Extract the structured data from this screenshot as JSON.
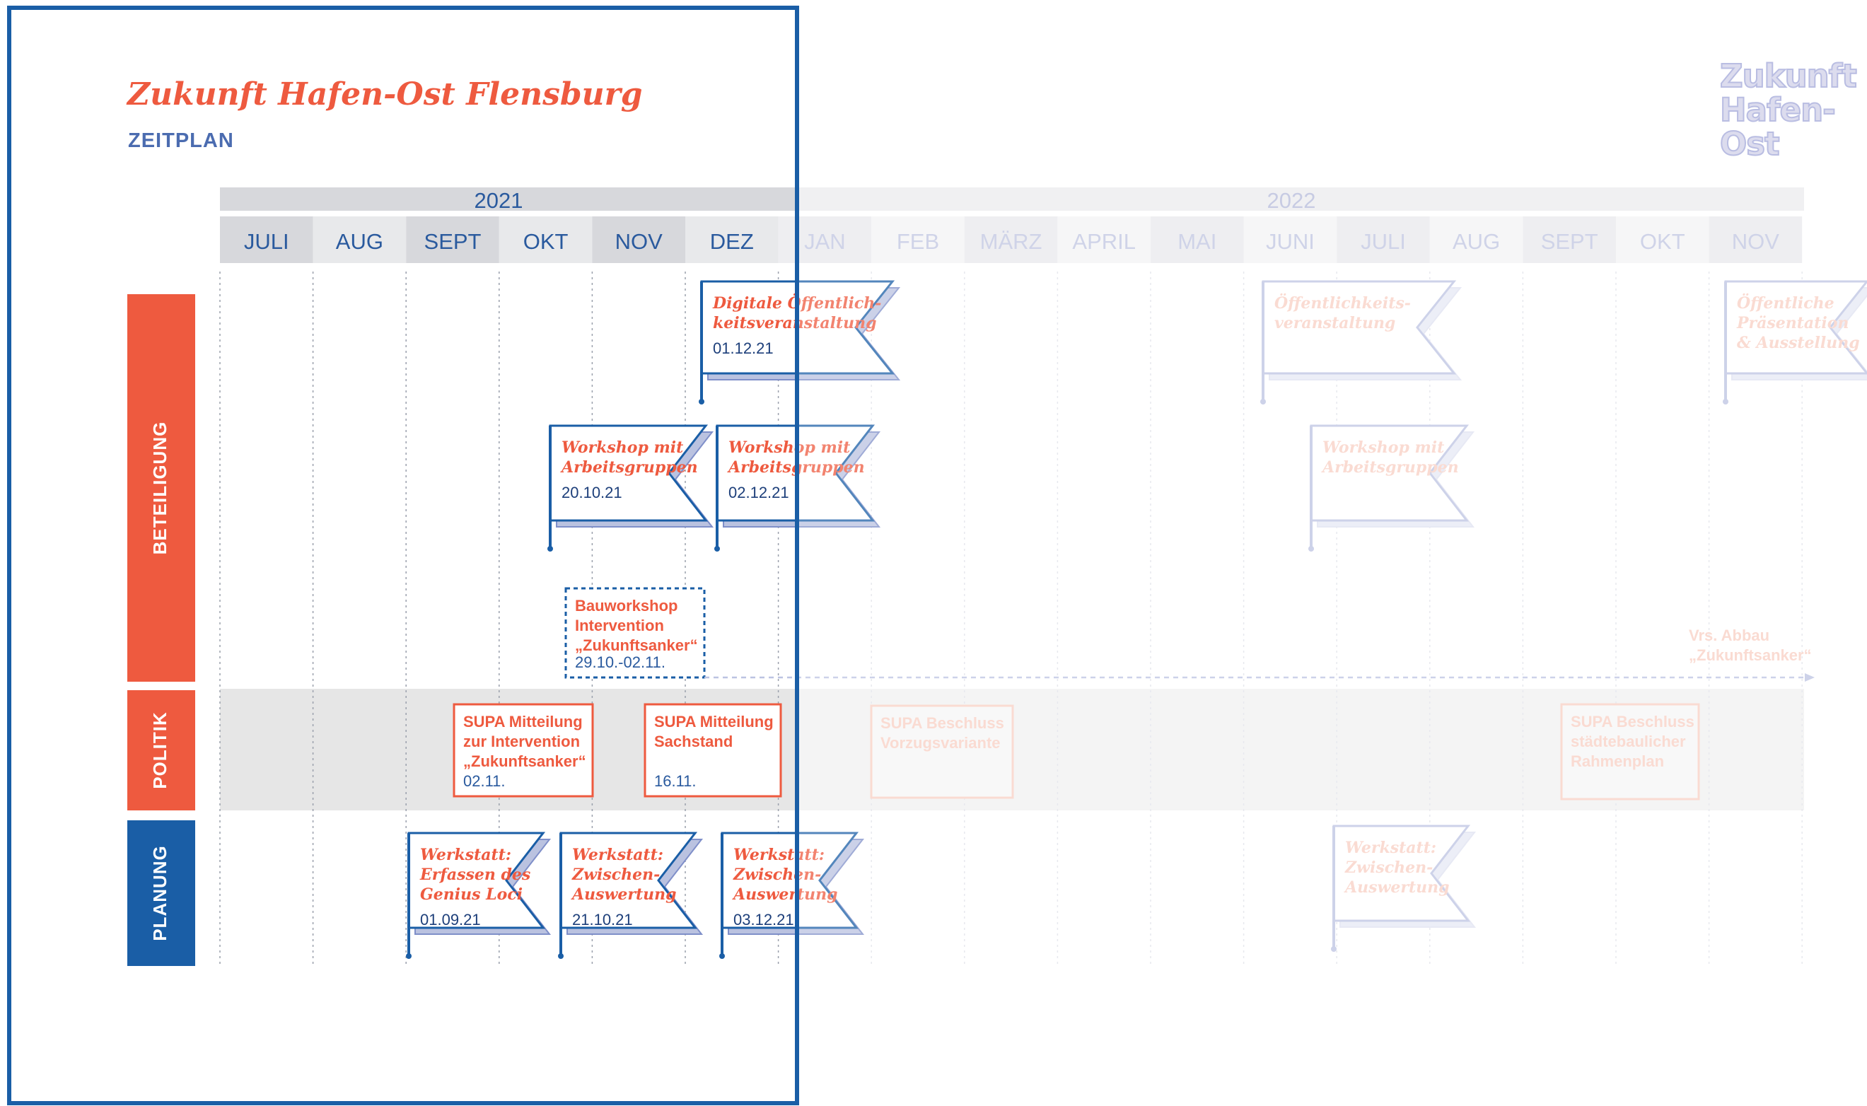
{
  "header": {
    "title": "Zukunft Hafen-Ost Flensburg",
    "subtitle": "ZEITPLAN",
    "logo_lines": [
      "Zukunft",
      "Hafen-",
      "Ost"
    ]
  },
  "colors": {
    "accent_red": "#ee5a3f",
    "brand_blue": "#1a5ea6",
    "subtitle_blue": "#4b6cb0",
    "faded_blue": "#bcc3e2",
    "faded_red": "#f9cfc3",
    "month_shade": "#d7d8dc",
    "month_light": "#e8e9eb",
    "politik_band": "#e6e6e6"
  },
  "years": [
    "2021",
    "2022"
  ],
  "months": [
    "JULI",
    "AUG",
    "SEPT",
    "OKT",
    "NOV",
    "DEZ",
    "JAN",
    "FEB",
    "MÄRZ",
    "APRIL",
    "MAI",
    "JUNI",
    "JULI",
    "AUG",
    "SEPT",
    "OKT",
    "NOV"
  ],
  "rows": {
    "beteiligung": "BETEILIGUNG",
    "politik": "POLITIK",
    "planung": "PLANUNG"
  },
  "flags": [
    {
      "name": "flag-digitale-oeffentlichkeitsveranstaltung",
      "lines": [
        "Digitale Öffentlich-",
        "keitsveranstaltung"
      ],
      "date": "01.12.21"
    },
    {
      "name": "flag-oeffentlichkeitsveranstaltung-2022",
      "lines": [
        "Öffentlichkeits-",
        "veranstaltung"
      ],
      "date": ""
    },
    {
      "name": "flag-oeffentliche-praesentation",
      "lines": [
        "Öffentliche",
        "Präsentation",
        "& Ausstellung"
      ],
      "date": ""
    },
    {
      "name": "flag-workshop-oct",
      "lines": [
        "Workshop mit",
        "Arbeitsgruppen"
      ],
      "date": "20.10.21"
    },
    {
      "name": "flag-workshop-dec",
      "lines": [
        "Workshop mit",
        "Arbeitsgruppen"
      ],
      "date": "02.12.21"
    },
    {
      "name": "flag-workshop-2022",
      "lines": [
        "Workshop mit",
        "Arbeitsgruppen"
      ],
      "date": ""
    },
    {
      "name": "flag-werkstatt-genius-loci",
      "lines": [
        "Werkstatt:",
        "Erfassen des",
        "Genius Loci"
      ],
      "date": "01.09.21"
    },
    {
      "name": "flag-werkstatt-zwischen-oct",
      "lines": [
        "Werkstatt:",
        "Zwischen-",
        "Auswertung"
      ],
      "date": "21.10.21"
    },
    {
      "name": "flag-werkstatt-zwischen-dec",
      "lines": [
        "Werkstatt:",
        "Zwischen-",
        "Auswertung"
      ],
      "date": "03.12.21"
    },
    {
      "name": "flag-werkstatt-zwischen-2022",
      "lines": [
        "Werkstatt:",
        "Zwischen-",
        "Auswertung"
      ],
      "date": ""
    }
  ],
  "boxes": [
    {
      "name": "box-bauworkshop",
      "lines": [
        "Bauworkshop",
        "Intervention",
        "„Zukunftsanker“"
      ],
      "date": "29.10.-02.11."
    },
    {
      "name": "box-supa-mitteilung-intervention",
      "lines": [
        "SUPA Mitteilung",
        "zur Intervention",
        "„Zukunftsanker“"
      ],
      "date": "02.11."
    },
    {
      "name": "box-supa-mitteilung-sachstand",
      "lines": [
        "SUPA Mitteilung",
        "Sachstand"
      ],
      "date": "16.11."
    },
    {
      "name": "box-supa-beschluss-vorzugsvariante",
      "lines": [
        "SUPA Beschluss",
        "Vorzugsvariante"
      ],
      "date": ""
    },
    {
      "name": "box-supa-beschluss-rahmenplan",
      "lines": [
        "SUPA Beschluss",
        "städtebaulicher",
        "Rahmenplan"
      ],
      "date": ""
    }
  ],
  "arrow_label": [
    "Vrs. Abbau",
    "„Zukunftsanker“"
  ]
}
